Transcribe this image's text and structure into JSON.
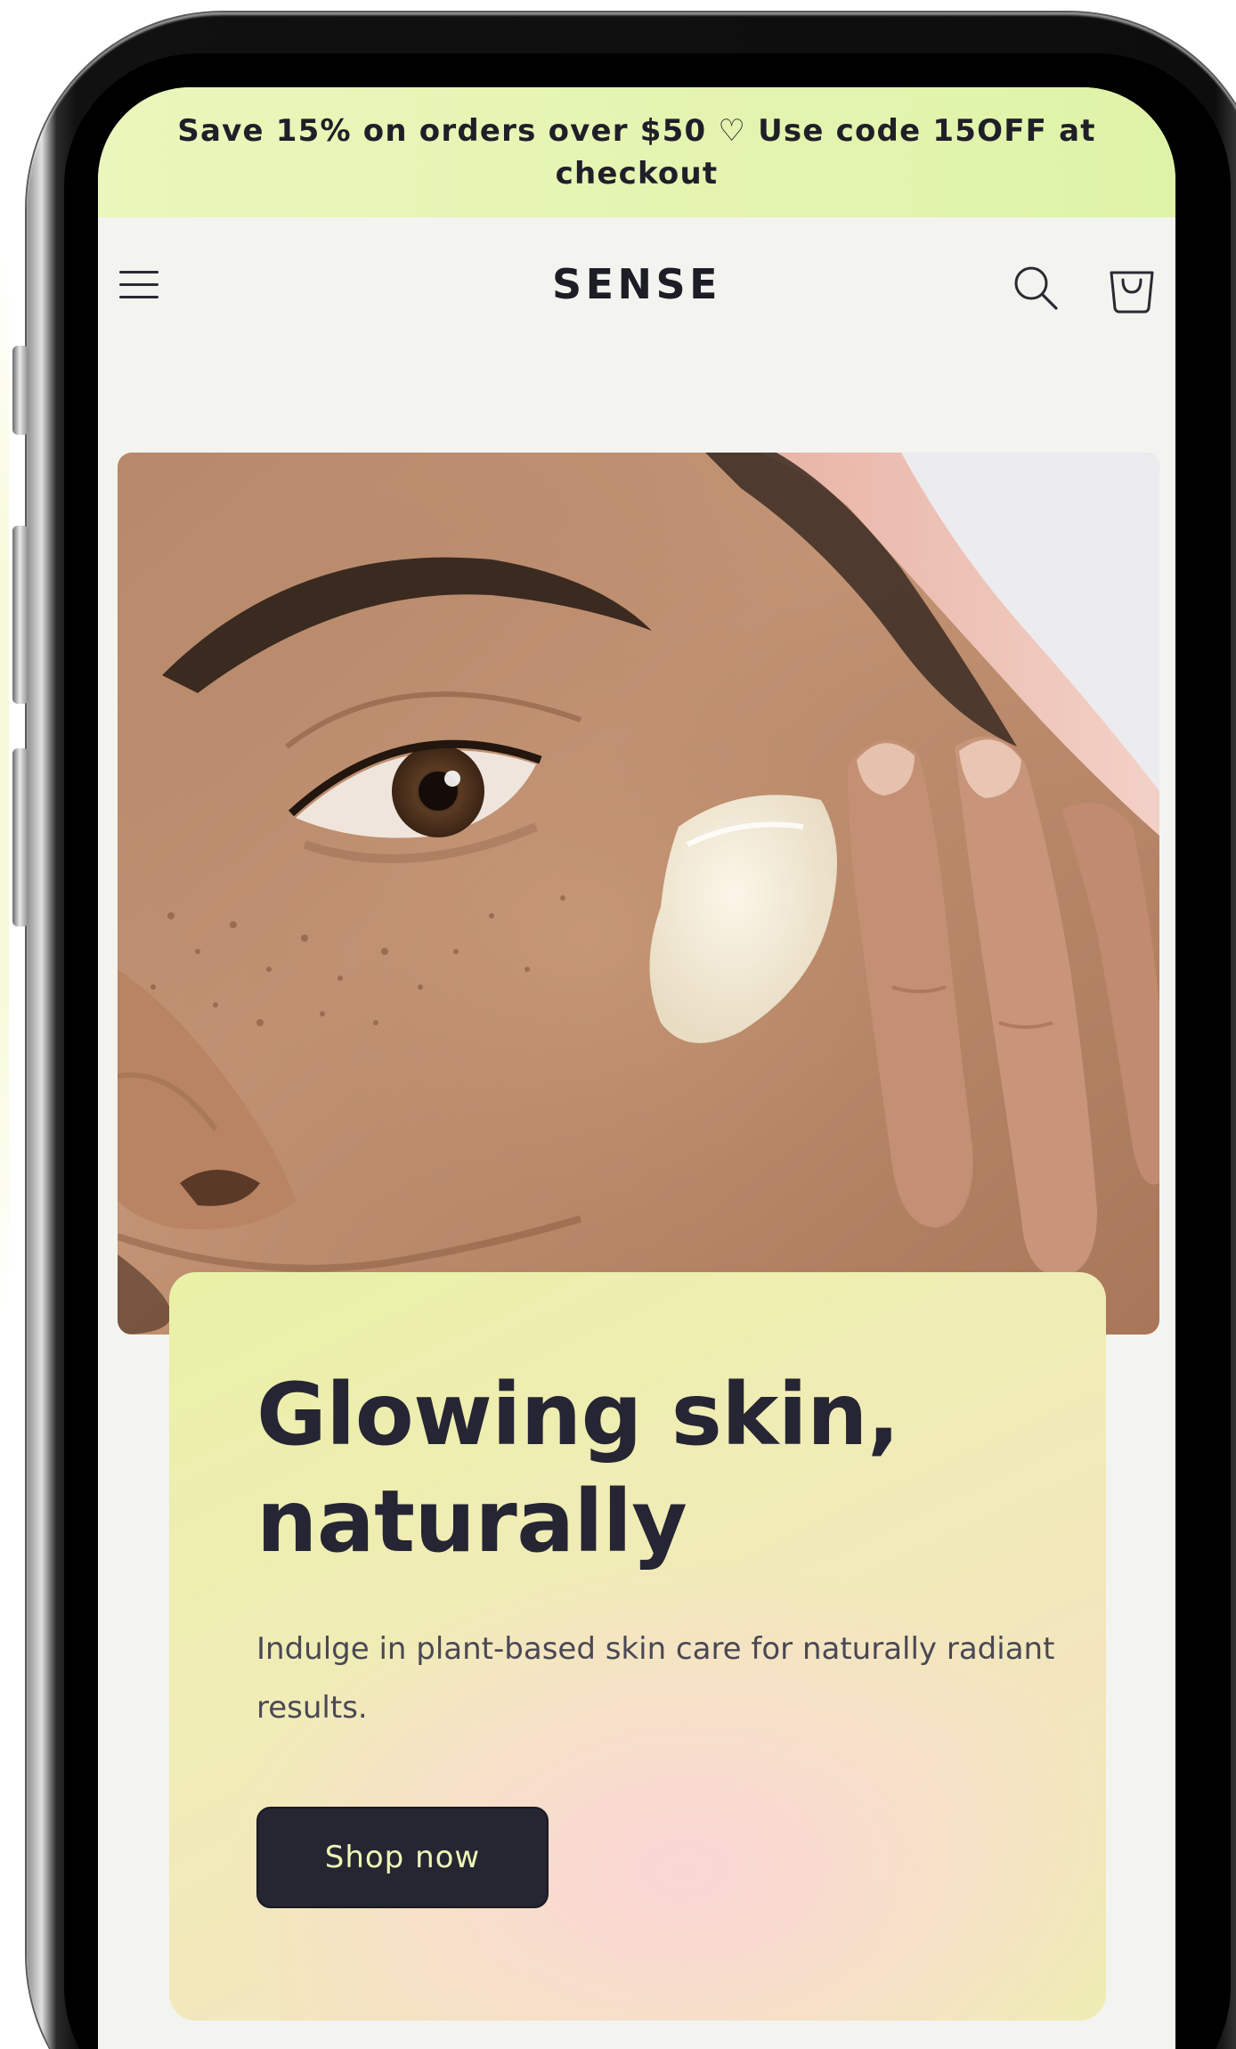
{
  "announcement": {
    "text": "Save 15% on orders over $50 ♡ Use code 15OFF at checkout"
  },
  "header": {
    "logo": "SENSE",
    "icons": [
      "menu-icon",
      "search-icon",
      "cart-icon"
    ]
  },
  "hero": {
    "title": "Glowing skin, naturally",
    "description": "Indulge in plant-based skin care for naturally radiant results.",
    "cta_label": "Shop now"
  },
  "colors": {
    "announcement_bg": "#e4f5b0",
    "page_bg": "#f3f4ef",
    "text_dark": "#262534",
    "button_bg": "#262632",
    "button_text": "#eef7b8"
  }
}
